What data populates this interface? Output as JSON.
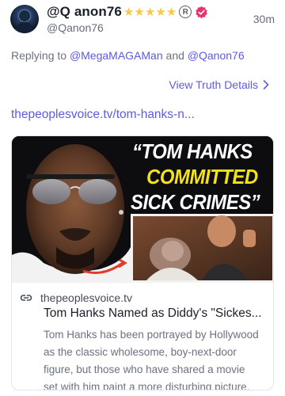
{
  "post": {
    "display_name": "@Q anon76",
    "star_count": 5,
    "handle": "@Qanon76",
    "time": "30m",
    "replying": {
      "prefix": "Replying to ",
      "mention1": "@MegaMAGAMan",
      "joiner": " and ",
      "mention2": "@Qanon76"
    },
    "view_details_label": "View Truth Details",
    "link_text": "thepeoplesvoice.tv/tom-hanks-n...",
    "card": {
      "headline": {
        "line1": "“TOM HANKS",
        "line2": "COMMITTED",
        "line3": "SICK CRIMES”"
      },
      "domain": "thepeoplesvoice.tv",
      "title": "Tom Hanks Named as Diddy's \"Sickes...",
      "description_lines": [
        "Tom Hanks has been portrayed by Hollywood",
        "as the classic wholesome, boy-next-door",
        "figure, but those who have shared a movie",
        "set with him paint a more disturbing picture."
      ]
    }
  },
  "colors": {
    "accent": "#5d5ae6",
    "star": "#f7c948",
    "verified": "#e8336e",
    "headline_yellow": "#f4e11a"
  },
  "icons": {
    "avatar": "avatar-image",
    "stars": "gold-star-icon",
    "registered": "registered-badge-icon",
    "verified": "verified-badge-icon",
    "chevron": "chevron-right-icon",
    "link": "link-icon"
  }
}
